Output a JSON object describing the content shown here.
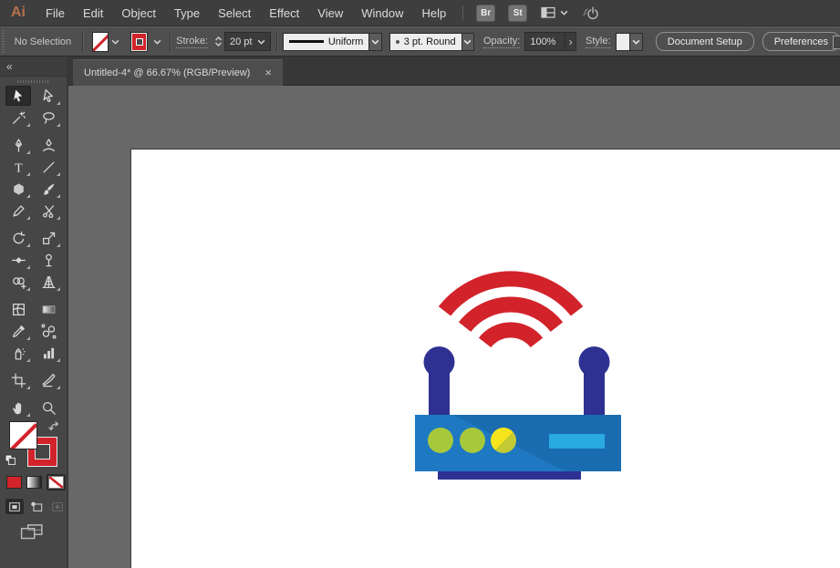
{
  "menu_bar": {
    "logo_text": "Ai",
    "items": [
      "File",
      "Edit",
      "Object",
      "Type",
      "Select",
      "Effect",
      "View",
      "Window",
      "Help"
    ],
    "bridge_label": "Br",
    "stock_label": "St"
  },
  "control_bar": {
    "selection_status": "No Selection",
    "stroke_label": "Stroke:",
    "stroke_weight": "20 pt",
    "width_profile": "Uniform",
    "brush": "3 pt. Round",
    "opacity_label": "Opacity:",
    "opacity_value": "100%",
    "opacity_arrow": "›",
    "style_label": "Style:",
    "document_setup": "Document Setup",
    "preferences": "Preferences"
  },
  "tab_bar": {
    "tabs": [
      {
        "title": "Untitled-4* @ 66.67% (RGB/Preview)",
        "close_glyph": "×",
        "active": true
      }
    ]
  },
  "toolbar": {
    "collapse_glyph": "«",
    "group_breaks": [
      1,
      5,
      8,
      11,
      12
    ],
    "tools": [
      {
        "name": "selection-tool",
        "selected": true,
        "flyout": false
      },
      {
        "name": "direct-selection-tool",
        "selected": false,
        "flyout": true
      },
      {
        "name": "magic-wand-tool",
        "selected": false,
        "flyout": true
      },
      {
        "name": "lasso-tool",
        "selected": false,
        "flyout": true
      },
      {
        "name": "pen-tool",
        "selected": false,
        "flyout": true
      },
      {
        "name": "curvature-tool",
        "selected": false,
        "flyout": false
      },
      {
        "name": "type-tool",
        "selected": false,
        "flyout": true
      },
      {
        "name": "line-segment-tool",
        "selected": false,
        "flyout": true
      },
      {
        "name": "polygon-tool",
        "selected": false,
        "flyout": true
      },
      {
        "name": "paintbrush-tool",
        "selected": false,
        "flyout": true
      },
      {
        "name": "shaper-tool",
        "selected": false,
        "flyout": true
      },
      {
        "name": "scissors-tool",
        "selected": false,
        "flyout": true
      },
      {
        "name": "rotate-tool",
        "selected": false,
        "flyout": true
      },
      {
        "name": "scale-tool",
        "selected": false,
        "flyout": true
      },
      {
        "name": "width-tool",
        "selected": false,
        "flyout": true
      },
      {
        "name": "puppet-warp-tool",
        "selected": false,
        "flyout": false
      },
      {
        "name": "shape-builder-tool",
        "selected": false,
        "flyout": true
      },
      {
        "name": "perspective-grid-tool",
        "selected": false,
        "flyout": true
      },
      {
        "name": "mesh-tool",
        "selected": false,
        "flyout": false
      },
      {
        "name": "gradient-tool",
        "selected": false,
        "flyout": false
      },
      {
        "name": "eyedropper-tool",
        "selected": false,
        "flyout": true
      },
      {
        "name": "blend-tool",
        "selected": false,
        "flyout": false
      },
      {
        "name": "symbol-sprayer-tool",
        "selected": false,
        "flyout": true
      },
      {
        "name": "column-graph-tool",
        "selected": false,
        "flyout": true
      },
      {
        "name": "artboard-tool",
        "selected": false,
        "flyout": true
      },
      {
        "name": "slice-tool",
        "selected": false,
        "flyout": true
      },
      {
        "name": "hand-tool",
        "selected": false,
        "flyout": true
      },
      {
        "name": "zoom-tool",
        "selected": false,
        "flyout": false
      }
    ]
  },
  "artwork": {
    "description": "Flat-style wifi router illustration: three red signal arcs above a blue router body with two dark blue antennas, three indicator LEDs (two green, one yellow) and a light blue display bar",
    "wifi_arcs": 3,
    "antennas": 2,
    "leds": 3,
    "colors": {
      "signal_red": "#D2232A",
      "antenna_blue": "#2E3192",
      "body_blue": "#1E79C2",
      "body_shade": "#1A6CB0",
      "display_blue": "#29ABE2",
      "led_green": "#A8C83C",
      "led_yellow": "#F6E51C",
      "led_yellow_shade": "#C2CB33"
    }
  },
  "colors": {
    "canvas_bg": "#686868",
    "panel_bg": "#464646",
    "bar_bg": "#4F4F4F",
    "menu_bg": "#3E3E3E",
    "accent_red": "#D2232A"
  }
}
